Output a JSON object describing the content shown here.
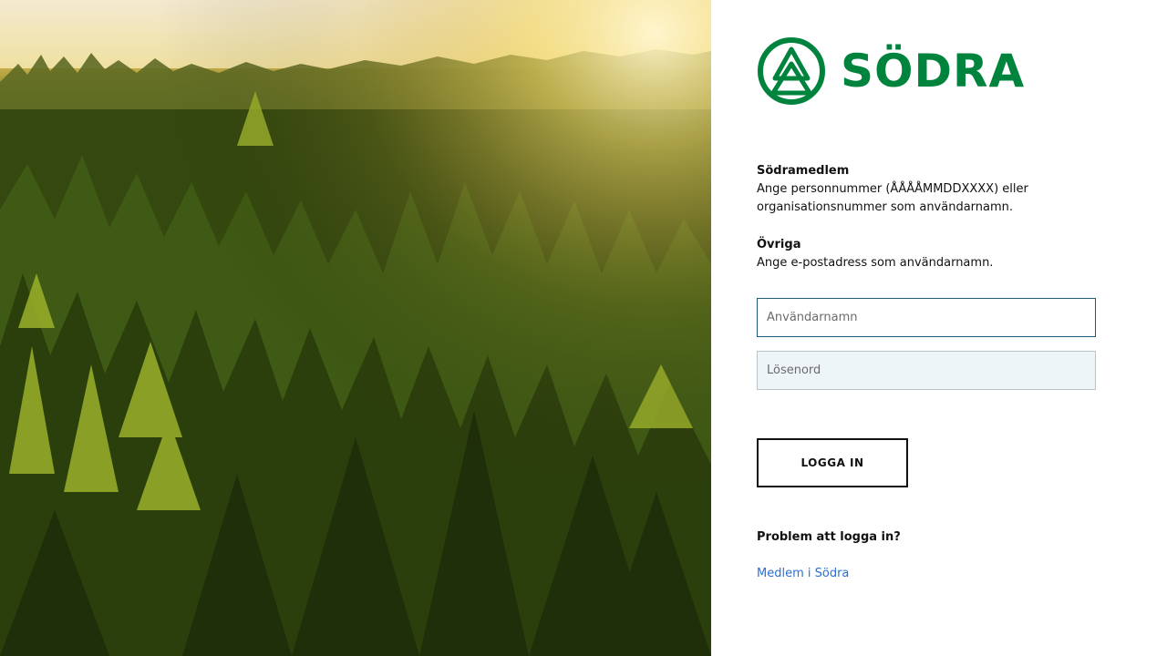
{
  "brand": {
    "name": "SÖDRA",
    "color": "#00843d"
  },
  "hero": {
    "description_icon": "forest-image"
  },
  "info": {
    "member_heading": "Södramedlem",
    "member_text": "Ange personnummer (ÅÅÅÅMMDDXXXX) eller organisationsnummer som användarnamn.",
    "other_heading": "Övriga",
    "other_text": "Ange e-postadress som användarnamn."
  },
  "form": {
    "username_placeholder": "Användarnamn",
    "password_placeholder": "Lösenord",
    "login_label": "LOGGA IN"
  },
  "help": {
    "problem_text": "Problem att logga in?",
    "member_link": "Medlem i Södra"
  },
  "colors": {
    "link": "#2a6fd6",
    "username_border": "#1f5a78",
    "password_bg": "#eef5f8"
  }
}
